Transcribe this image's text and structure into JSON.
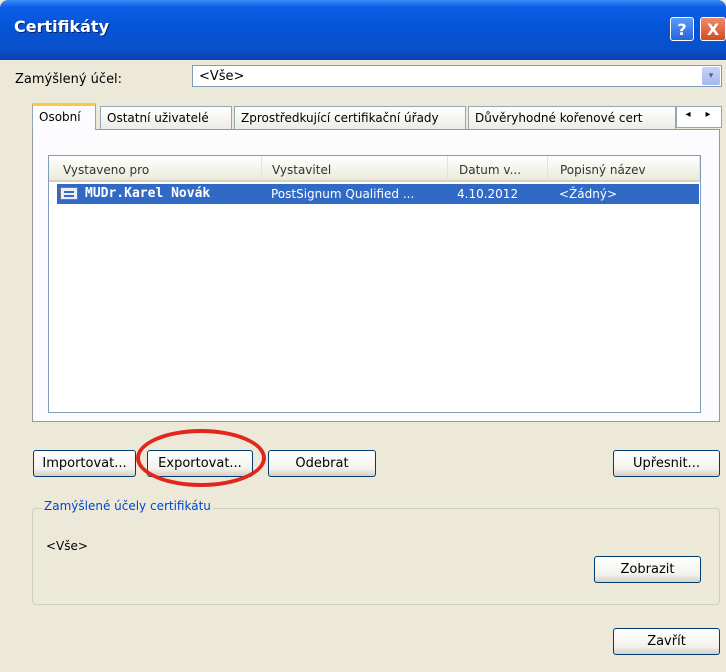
{
  "window": {
    "title": "Certifikáty",
    "help_btn": "?",
    "close_btn": "X"
  },
  "purpose": {
    "label": "Zamýšlený účel:",
    "value": "<Vše>",
    "arrow": "▾"
  },
  "tabs": [
    {
      "label": "Osobní"
    },
    {
      "label": "Ostatní uživatelé"
    },
    {
      "label": "Zprostředkující certifikační úřady"
    },
    {
      "label": "Důvěryhodné kořenové cert"
    }
  ],
  "tab_scroll": {
    "left": "◂",
    "right": "▸"
  },
  "list": {
    "columns": [
      "Vystaveno pro",
      "Vystavitel",
      "Datum v...",
      "Popisný název"
    ],
    "rows": [
      {
        "issued_to": "MUDr.Karel Novák",
        "issuer": "PostSignum Qualified ...",
        "date": "4.10.2012",
        "friendly_name": "<Žádný>"
      }
    ]
  },
  "buttons": {
    "import": "Importovat...",
    "export": "Exportovat...",
    "remove": "Odebrat",
    "advanced": "Upřesnit...",
    "view": "Zobrazit",
    "close": "Zavřít"
  },
  "purposes_group": {
    "title": "Zamýšlené účely certifikátu",
    "value": "<Vše>"
  },
  "colors": {
    "titlebar": "#0653d4",
    "selection": "#316ac5",
    "highlight_ellipse": "#e0261d"
  }
}
